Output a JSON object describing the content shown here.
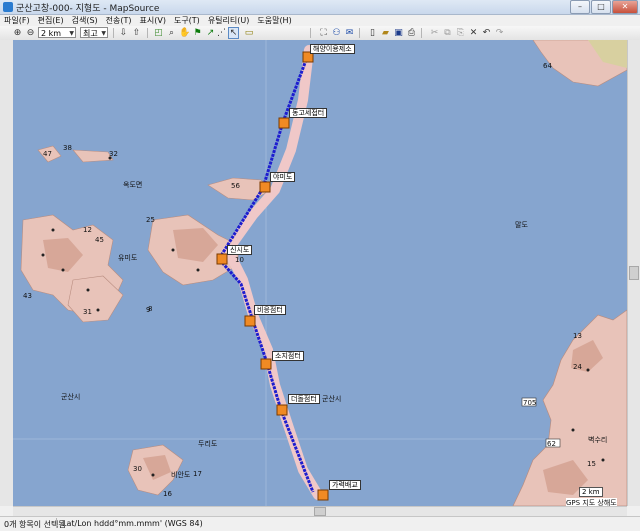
{
  "window": {
    "title": "군산고창-000- 지형도 - MapSource",
    "buttons": [
      "–",
      "□",
      "✕"
    ]
  },
  "menu": [
    "파일(F)",
    "편집(E)",
    "검색(S)",
    "전송(T)",
    "표시(V)",
    "도구(T)",
    "유틸리티(U)",
    "도움말(H)"
  ],
  "toolbar": {
    "zoom_value": "2 km",
    "detail_value": "최고",
    "icons": [
      "zoom-in-icon",
      "zoom-out-icon",
      "binoculars-icon",
      "hand-icon",
      "waypoint-flag-icon",
      "route-icon",
      "select-arrow-icon",
      "track-icon",
      "new-icon",
      "open-icon",
      "save-icon",
      "print-icon",
      "cut-icon",
      "copy-icon",
      "paste-icon",
      "undo-icon",
      "redo-icon"
    ]
  },
  "map": {
    "waypoints": [
      "해양이용제소",
      "동고세접터",
      "야미도",
      "신시도",
      "비응점터",
      "소지점터",
      "더돌점터",
      "가력배교"
    ],
    "place_labels": [
      "옥도면",
      "군산시",
      "군산시",
      "두리도",
      "말도",
      "비안도",
      "벽수리",
      "유미도"
    ],
    "numbers": [
      "38",
      "32",
      "47",
      "43",
      "64",
      "25",
      "12",
      "56",
      "10",
      "9",
      "31",
      "24",
      "62",
      "15",
      "705",
      "30",
      "17",
      "16",
      "13",
      "8",
      "45"
    ],
    "scale_text": "2 km",
    "footer_text": "GPS 지도 상해도"
  },
  "status": {
    "selection": "0개 항목이 선택됨",
    "coords": "Lat/Lon hddd°mm.mmm' (WGS 84)"
  },
  "colors": {
    "water": "#86a5cf",
    "land": "#e8c3b9",
    "route": "#1d1dcf"
  }
}
